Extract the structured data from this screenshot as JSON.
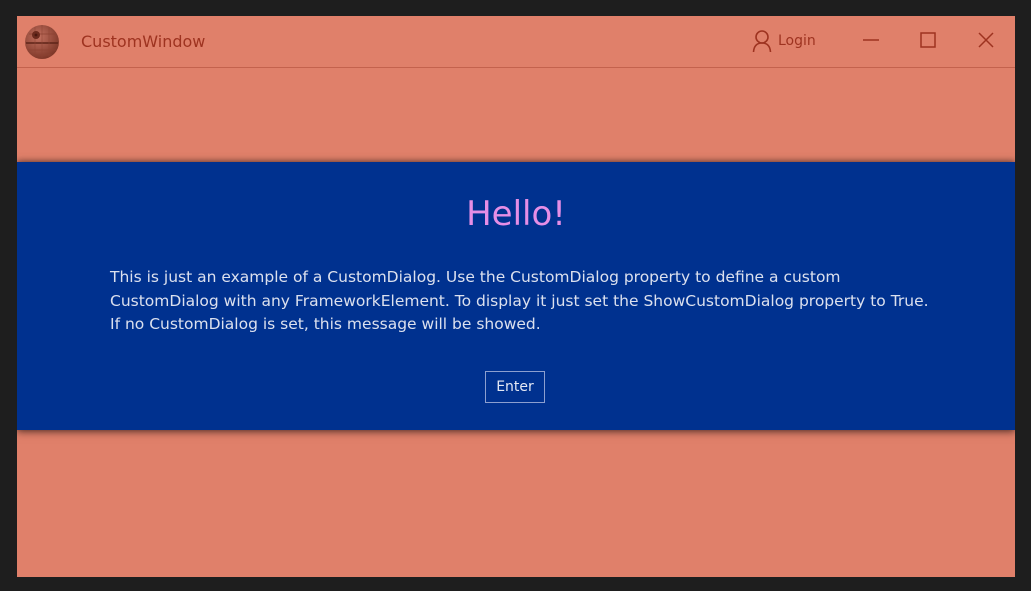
{
  "window": {
    "title": "CustomWindow",
    "login_label": "Login"
  },
  "dialog": {
    "title": "Hello!",
    "message": "This is just an example of a CustomDialog. Use the CustomDialog property to define a custom\nCustomDialog with any FrameworkElement. To display it just set the ShowCustomDialog property to True.\nIf no CustomDialog is set, this message will be showed.",
    "enter_label": "Enter"
  },
  "colors": {
    "window_background": "#e0806a",
    "title_text": "#9e3320",
    "dialog_background": "#00318f",
    "dialog_title": "#e58ee6",
    "dialog_text": "#dbe0ee",
    "outer_frame": "#1e1e1e"
  },
  "icons": {
    "app": "death-star-icon",
    "login": "user-icon",
    "minimize": "minimize-icon",
    "maximize": "maximize-icon",
    "close": "close-icon"
  }
}
